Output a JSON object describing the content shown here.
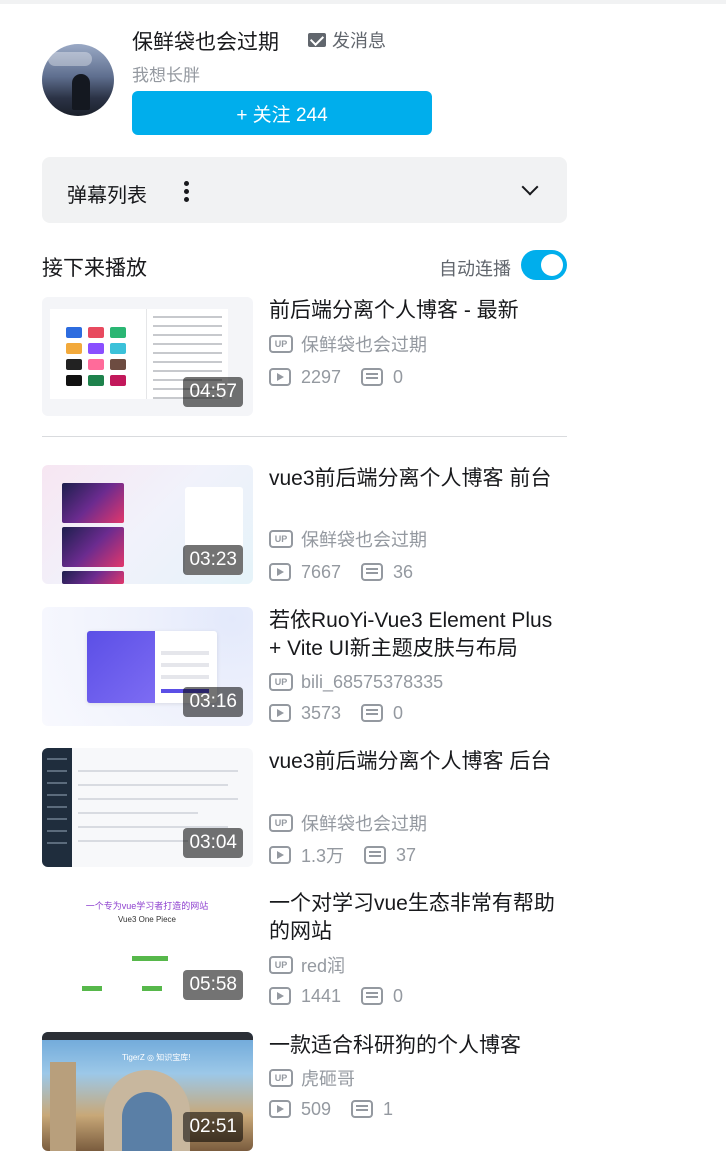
{
  "uploader": {
    "name": "保鲜袋也会过期",
    "message_label": "发消息",
    "signature": "我想长胖",
    "follow_label": "+ 关注 244"
  },
  "danmaku": {
    "label": "弹幕列表"
  },
  "next": {
    "title": "接下来播放",
    "autoplay_label": "自动连播",
    "autoplay_on": true
  },
  "up_badge": "UP",
  "videos": [
    {
      "title": "前后端分离个人博客 - 最新",
      "duration": "04:57",
      "up": "保鲜袋也会过期",
      "views": "2297",
      "danmaku": "0"
    },
    {
      "title": "vue3前后端分离个人博客 前台",
      "duration": "03:23",
      "up": "保鲜袋也会过期",
      "views": "7667",
      "danmaku": "36"
    },
    {
      "title": "若依RuoYi-Vue3 Element Plus + Vite UI新主题皮肤与布局",
      "duration": "03:16",
      "up": "bili_68575378335",
      "views": "3573",
      "danmaku": "0"
    },
    {
      "title": "vue3前后端分离个人博客 后台",
      "duration": "03:04",
      "up": "保鲜袋也会过期",
      "views": "1.3万",
      "danmaku": "37"
    },
    {
      "title": "一个对学习vue生态非常有帮助的网站",
      "duration": "05:58",
      "up": "red润",
      "views": "1441",
      "danmaku": "0"
    },
    {
      "title": "一款适合科研狗的个人博客",
      "duration": "02:51",
      "up": "虎砸哥",
      "views": "509",
      "danmaku": "1"
    }
  ],
  "thumb_texts": {
    "v5_heading": "一个专为vue学习者打造的网站",
    "v5_sub": "Vue3 One Piece",
    "v6_banner": "TigerZ ◎ 知识宝库!"
  }
}
